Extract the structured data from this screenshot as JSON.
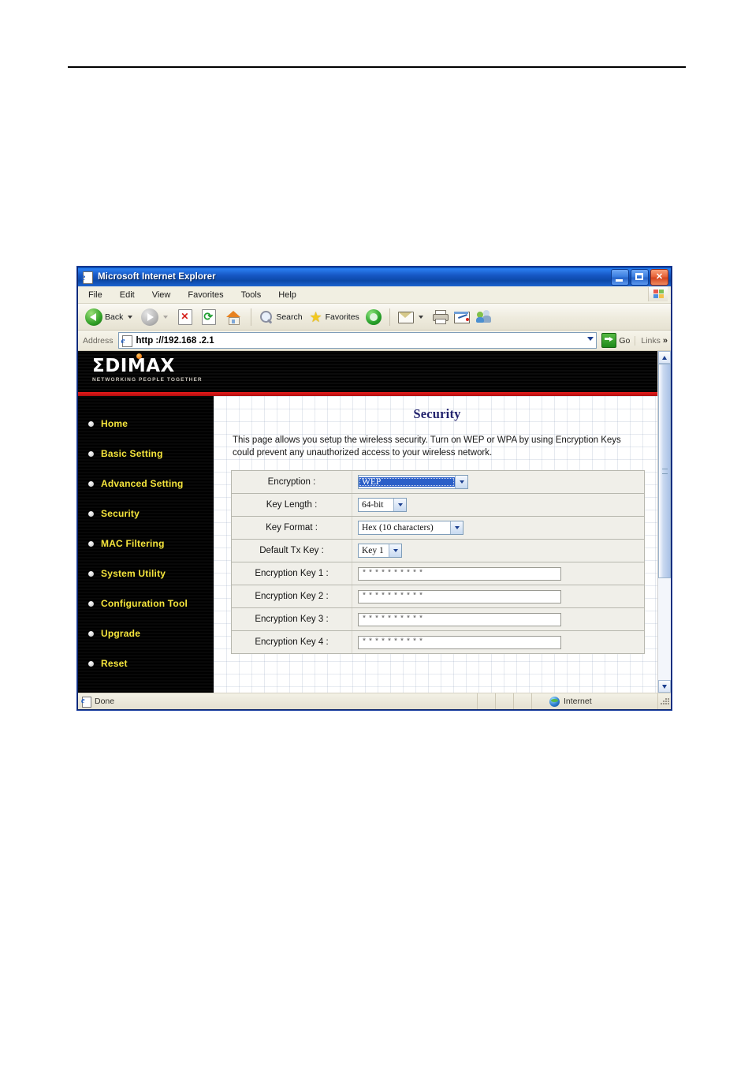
{
  "window": {
    "title": "Microsoft Internet Explorer",
    "icon": "ie-page-icon",
    "controls": {
      "minimize": "Minimize",
      "maximize": "Maximize",
      "close": "Close"
    }
  },
  "menu": {
    "items": [
      "File",
      "Edit",
      "View",
      "Favorites",
      "Tools",
      "Help"
    ]
  },
  "toolbar": {
    "back": "Back",
    "forward": "",
    "stop": "",
    "refresh": "",
    "home": "",
    "search": "Search",
    "favorites": "Favorites",
    "media": "",
    "mail": "",
    "print": "",
    "edit": "",
    "messenger": ""
  },
  "address": {
    "label": "Address",
    "url": "http ://192.168 .2.1",
    "go_label": "Go",
    "links_label": "Links",
    "links_chevron": "»"
  },
  "brand": {
    "name": "ΣDIMAX",
    "tagline": "NETWORKING PEOPLE TOGETHER"
  },
  "sidebar": {
    "items": [
      {
        "label": "Home"
      },
      {
        "label": "Basic Setting"
      },
      {
        "label": "Advanced Setting"
      },
      {
        "label": "Security"
      },
      {
        "label": "MAC Filtering"
      },
      {
        "label": "System Utility"
      },
      {
        "label": "Configuration Tool"
      },
      {
        "label": "Upgrade"
      },
      {
        "label": "Reset"
      }
    ]
  },
  "page": {
    "title": "Security",
    "description": "This page allows you setup the wireless security. Turn on WEP or WPA by using Encryption Keys could prevent any unauthorized access to your wireless network.",
    "rows": [
      {
        "label": "Encryption :",
        "value": "WEP",
        "type": "select",
        "highlighted": true
      },
      {
        "label": "Key Length :",
        "value": "64-bit",
        "type": "select",
        "highlighted": false
      },
      {
        "label": "Key Format :",
        "value": "Hex (10 characters)",
        "type": "select",
        "highlighted": false
      },
      {
        "label": "Default Tx Key :",
        "value": "Key 1",
        "type": "select",
        "highlighted": false
      },
      {
        "label": "Encryption Key 1 :",
        "value": "**********",
        "type": "password"
      },
      {
        "label": "Encryption Key 2 :",
        "value": "**********",
        "type": "password"
      },
      {
        "label": "Encryption Key 3 :",
        "value": "**********",
        "type": "password"
      },
      {
        "label": "Encryption Key 4 :",
        "value": "**********",
        "type": "password"
      }
    ]
  },
  "status": {
    "text": "Done",
    "zone": "Internet"
  },
  "colors": {
    "nav_text": "#f5e53c",
    "title_text": "#24246e",
    "accent_red": "#e81b1b",
    "select_highlight": "#2a5fc8"
  }
}
